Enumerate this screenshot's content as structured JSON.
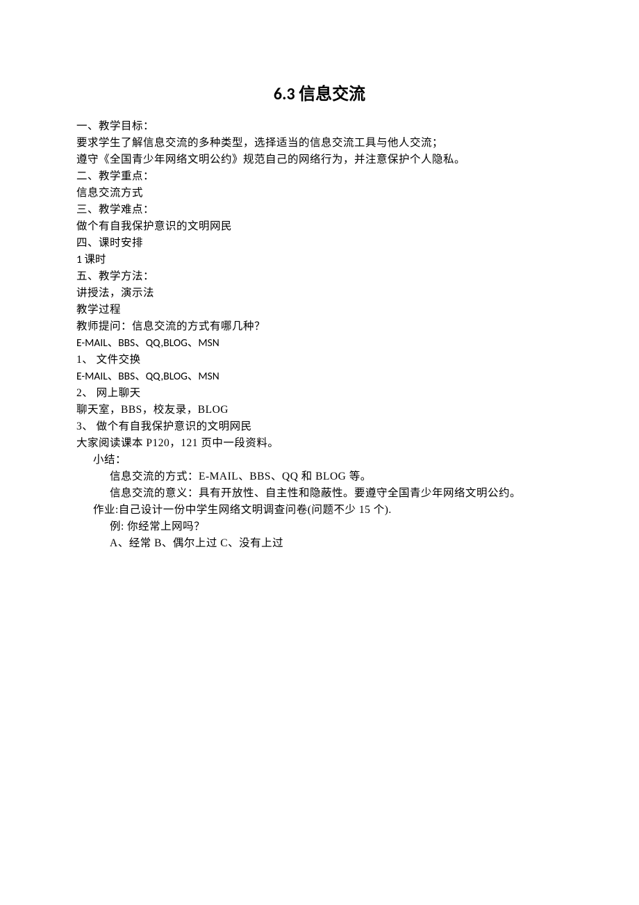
{
  "title": "6.3 信息交流",
  "lines": {
    "l1": "一、教学目标：",
    "l2": "要求学生了解信息交流的多种类型，选择适当的信息交流工具与他人交流；",
    "l3": "遵守《全国青少年网络文明公约》规范自己的网络行为，并注意保护个人隐私。",
    "l4": "二、教学重点：",
    "l5": "信息交流方式",
    "l6": "三、教学难点：",
    "l7": "做个有自我保护意识的文明网民",
    "l8": "四、课时安排",
    "l9": "1 课时",
    "l10": "五、教学方法：",
    "l11": "讲授法，演示法",
    "l12": "教学过程",
    "l13": "教师提问：信息交流的方式有哪几种？",
    "l14": "E-MAIL、BBS、QQ,BLOG、MSN",
    "l15": "1、  文件交换",
    "l16": "E-MAIL、BBS、QQ,BLOG、MSN",
    "l17": "2、  网上聊天",
    "l18": "聊天室，BBS，校友录，BLOG",
    "l19": "3、  做个有自我保护意识的文明网民",
    "l20": "大家阅读课本 P120，121 页中一段资料。",
    "l21": "小结：",
    "l22": "信息交流的方式：E-MAIL、BBS、QQ 和 BLOG 等。",
    "l23": "信息交流的意义：具有开放性、自主性和隐蔽性。要遵守全国青少年网络文明公约。",
    "l24": "作业:自己设计一份中学生网络文明调查问卷(问题不少 15 个).",
    "l25": "例:  你经常上网吗？",
    "l26": "A、经常  B、偶尔上过  C、没有上过"
  }
}
